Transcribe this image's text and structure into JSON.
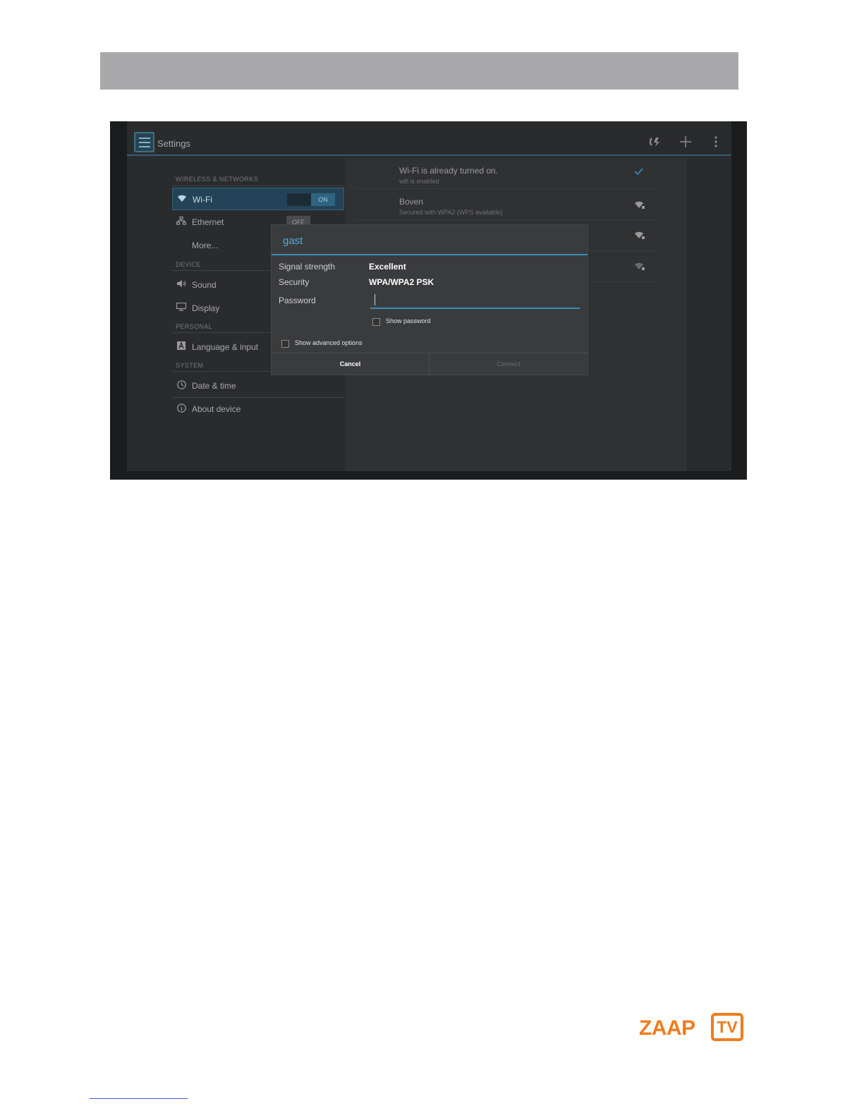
{
  "actionbar": {
    "title": "Settings",
    "icons": [
      "wps-icon",
      "add-icon",
      "overflow-menu-icon"
    ]
  },
  "sidebar": {
    "sections": [
      {
        "header": "WIRELESS & NETWORKS"
      },
      {
        "header": "DEVICE"
      },
      {
        "header": "PERSONAL"
      },
      {
        "header": "SYSTEM"
      }
    ],
    "items": [
      {
        "label": "Wi-Fi",
        "icon": "wifi-icon",
        "toggle": "ON"
      },
      {
        "label": "Ethernet",
        "icon": "ethernet-icon",
        "toggle": "OFF"
      },
      {
        "label": "More..."
      },
      {
        "label": "Sound",
        "icon": "sound-icon"
      },
      {
        "label": "Display",
        "icon": "display-icon"
      },
      {
        "label": "Language & input",
        "icon": "language-icon"
      },
      {
        "label": "Date & time",
        "icon": "clock-icon"
      },
      {
        "label": "About device",
        "icon": "info-icon"
      }
    ]
  },
  "networks": [
    {
      "title": "Wi-Fi is already turned on.",
      "subtitle": "wifi is enabled",
      "icon": "check-icon"
    },
    {
      "title": "Boven",
      "subtitle": "Secured with WPA2 (WPS available)",
      "icon": "wifi-lock-icon"
    },
    {
      "icon": "wifi-lock-icon"
    },
    {
      "icon": "wifi-lock-icon"
    }
  ],
  "dialog": {
    "title": "gast",
    "signal_label": "Signal strength",
    "signal_value": "Excellent",
    "security_label": "Security",
    "security_value": "WPA/WPA2 PSK",
    "password_label": "Password",
    "password_value": "",
    "show_password_label": "Show password",
    "show_password_checked": false,
    "advanced_label": "Show advanced options",
    "advanced_checked": false,
    "cancel_label": "Cancel",
    "connect_label": "Connect"
  },
  "logo": {
    "text": "ZAAP",
    "tv": "TV"
  },
  "colors": {
    "accent": "#3b8bb8",
    "dialog_title": "#4fa9d9",
    "logo": "#f07c1d"
  }
}
